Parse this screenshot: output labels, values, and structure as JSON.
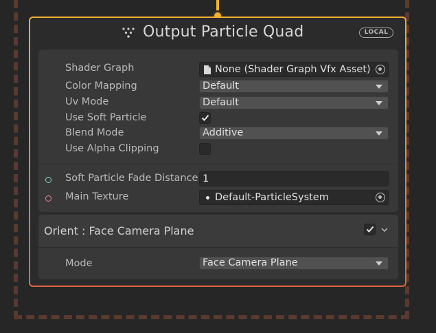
{
  "node": {
    "title": "Output Particle Quad",
    "badge": "LOCAL",
    "title_icon": "vfx-output-icon"
  },
  "properties": [
    {
      "label": "Shader Graph",
      "type": "object",
      "value": "None (Shader Graph Vfx Asset)",
      "icon": "file-icon"
    },
    {
      "label": "Color Mapping",
      "type": "dropdown",
      "value": "Default"
    },
    {
      "label": "Uv Mode",
      "type": "dropdown",
      "value": "Default"
    },
    {
      "label": "Use Soft Particle",
      "type": "checkbox",
      "checked": true
    },
    {
      "label": "Blend Mode",
      "type": "dropdown",
      "value": "Additive"
    },
    {
      "label": "Use Alpha Clipping",
      "type": "checkbox",
      "checked": false
    }
  ],
  "inputs": [
    {
      "label": "Soft Particle Fade Distance",
      "type": "float",
      "value": "1",
      "port_color": "#7fd6c8"
    },
    {
      "label": "Main Texture",
      "type": "object",
      "value": "Default-ParticleSystem",
      "port_color": "#e48a8a"
    }
  ],
  "block": {
    "title": "Orient : Face Camera Plane",
    "enabled": true,
    "settings": [
      {
        "label": "Mode",
        "type": "dropdown",
        "value": "Face Camera Plane"
      }
    ]
  },
  "colors": {
    "node_border_top": "#f0b032",
    "node_border_bottom": "#e0663e",
    "connector": "#f2b32a",
    "system_border": "#5a3a2e",
    "background": "#262626"
  }
}
